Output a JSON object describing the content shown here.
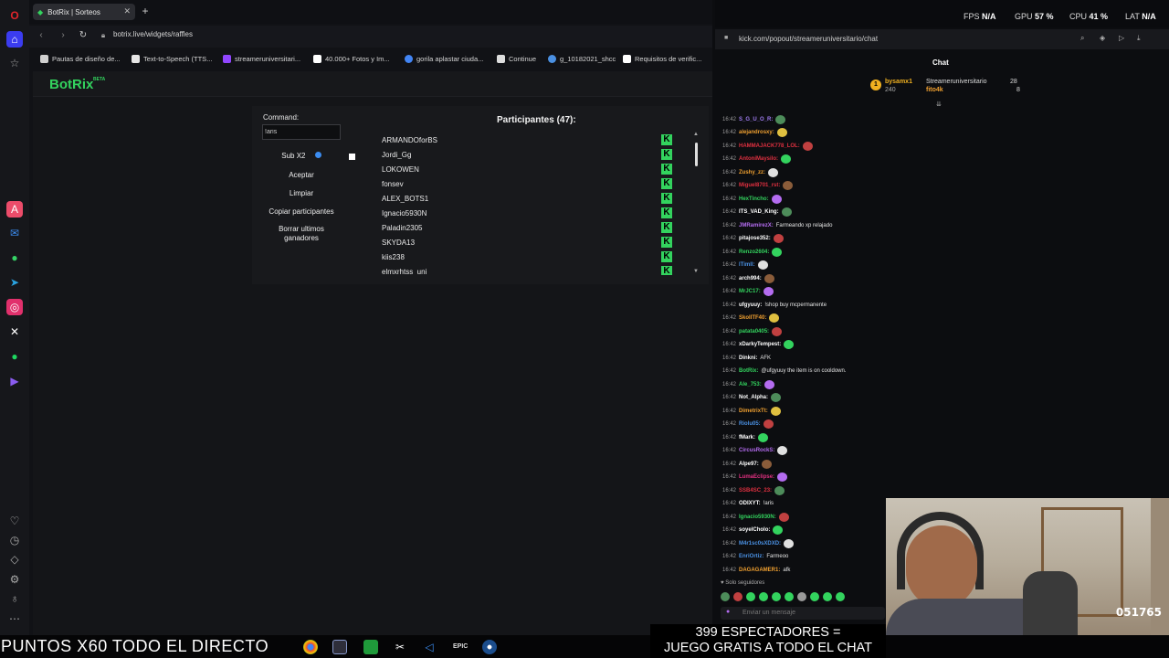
{
  "browser": {
    "tab_title": "BotRix | Sorteos",
    "url": "botrix.live/widgets/raffles",
    "bookmarks": [
      {
        "label": "Pautas de diseño de...",
        "color": "#d0d0d0"
      },
      {
        "label": "Text-to-Speech (TTS...",
        "color": "#e6e6e6"
      },
      {
        "label": "streameruniversitari...",
        "color": "#9146ff"
      },
      {
        "label": "40.000+ Fotos y Im...",
        "color": "#ffffff"
      },
      {
        "label": "gorila aplastar ciuda...",
        "color": "#4285f4"
      },
      {
        "label": "Continue",
        "color": "#dddddd"
      },
      {
        "label": "g_10182021_shcc",
        "color": "#4a90e2"
      },
      {
        "label": "Requisitos de verific...",
        "color": "#ffffff"
      }
    ]
  },
  "botrix": {
    "logo": "BotRix",
    "logo_beta": "BETA",
    "command_label": "Command:",
    "command_value": "!aris",
    "sub_label": "Sub X2",
    "accept": "Aceptar",
    "clear": "Limpiar",
    "copy": "Copiar participantes",
    "delete_winners": "Borrar ultimos ganadores",
    "participants_title": "Participantes (47):",
    "participants": [
      "ARMANDOforBS",
      "Jordi_Gg",
      "LOKOWEN",
      "fonsev",
      "ALEX_BOTS1",
      "Ignacio5930N",
      "Paladin2305",
      "SKYDA13",
      "kiis238",
      "elmxrhtss_uni"
    ],
    "platform_badge": "K",
    "accent": "#33d35e"
  },
  "system": {
    "fps_label": "FPS",
    "fps_value": "N/A",
    "gpu_label": "GPU",
    "gpu_value": "57 %",
    "cpu_label": "CPU",
    "cpu_value": "41 %",
    "lat_label": "LAT",
    "lat_value": "N/A"
  },
  "chat": {
    "url": "kick.com/popout/streameruniversitario/chat",
    "title": "Chat",
    "leaderboard": [
      {
        "rank": "1",
        "name": "bysamx1",
        "points": "240"
      },
      {
        "name": "Streameruniversitario",
        "points": "28"
      },
      {
        "name": "fito4k",
        "points": "8"
      }
    ],
    "messages": [
      {
        "time": "16:42",
        "user": "S_G_U_O_R:",
        "color": "#9f7cf0",
        "text": ""
      },
      {
        "time": "16:42",
        "user": "alejandrosxy:",
        "color": "#f0a030",
        "text": ""
      },
      {
        "time": "16:42",
        "user": "HAMMAJACK778_LOL:",
        "color": "#e03040",
        "text": ""
      },
      {
        "time": "16:42",
        "user": "AntoniMaysilo:",
        "color": "#e03040",
        "text": ""
      },
      {
        "time": "16:42",
        "user": "Zushy_zz:",
        "color": "#f0a030",
        "text": ""
      },
      {
        "time": "16:42",
        "user": "Miguel8701_rst:",
        "color": "#e03040",
        "text": ""
      },
      {
        "time": "16:42",
        "user": "HexTincho:",
        "color": "#33d35e",
        "text": ""
      },
      {
        "time": "16:42",
        "user": "ITS_VAD_King:",
        "color": "#ffffff",
        "text": ""
      },
      {
        "time": "16:42",
        "user": "JMRamirezX:",
        "color": "#b46cf0",
        "text": "Farmeando xp relajado"
      },
      {
        "time": "16:42",
        "user": "pitajose352:",
        "color": "#ffffff",
        "text": ""
      },
      {
        "time": "16:42",
        "user": "Renzo2604:",
        "color": "#33d35e",
        "text": ""
      },
      {
        "time": "16:42",
        "user": "lTimll:",
        "color": "#4a90e2",
        "text": ""
      },
      {
        "time": "16:42",
        "user": "arch994:",
        "color": "#ffffff",
        "text": ""
      },
      {
        "time": "16:42",
        "user": "MrJC17:",
        "color": "#33d35e",
        "text": ""
      },
      {
        "time": "16:42",
        "user": "ufgyuuy:",
        "color": "#ffffff",
        "text": "!shop buy mcpermanente"
      },
      {
        "time": "16:42",
        "user": "SkollTF40:",
        "color": "#f0a030",
        "text": ""
      },
      {
        "time": "16:42",
        "user": "patata0405:",
        "color": "#33d35e",
        "text": ""
      },
      {
        "time": "16:42",
        "user": "xDarkyTempest:",
        "color": "#ffffff",
        "text": ""
      },
      {
        "time": "16:42",
        "user": "Dinkni:",
        "color": "#ffffff",
        "text": "AFK"
      },
      {
        "time": "16:42",
        "user": "BotRix:",
        "color": "#33d35e",
        "text": "@ufgyuuy the item is on cooldown."
      },
      {
        "time": "16:42",
        "user": "Ale_753:",
        "color": "#33d35e",
        "text": ""
      },
      {
        "time": "16:42",
        "user": "Not_Alpha:",
        "color": "#ffffff",
        "text": ""
      },
      {
        "time": "16:42",
        "user": "DimetrixTt:",
        "color": "#f0a030",
        "text": ""
      },
      {
        "time": "16:42",
        "user": "Riolu05:",
        "color": "#4a90e2",
        "text": ""
      },
      {
        "time": "16:42",
        "user": "fMark:",
        "color": "#ffffff",
        "text": ""
      },
      {
        "time": "16:42",
        "user": "CircusRockS:",
        "color": "#b46cf0",
        "text": ""
      },
      {
        "time": "16:42",
        "user": "Alpe97:",
        "color": "#ffffff",
        "text": ""
      },
      {
        "time": "16:42",
        "user": "LumaEclipse:",
        "color": "#e03080",
        "text": ""
      },
      {
        "time": "16:42",
        "user": "SSB4SC_23:",
        "color": "#e03040",
        "text": ""
      },
      {
        "time": "16:42",
        "user": "ODIXYT:",
        "color": "#ffffff",
        "text": "!aris"
      },
      {
        "time": "16:42",
        "user": "Ignacio5930N:",
        "color": "#33d35e",
        "text": ""
      },
      {
        "time": "16:42",
        "user": "soyelCholo:",
        "color": "#ffffff",
        "text": ""
      },
      {
        "time": "16:42",
        "user": "M4r1sc0sXDXD:",
        "color": "#4a90e2",
        "text": ""
      },
      {
        "time": "16:42",
        "user": "EnriOrtiz:",
        "color": "#4a90e2",
        "text": "Farmeoo"
      },
      {
        "time": "16:42",
        "user": "DAGAGAMER1:",
        "color": "#f0a030",
        "text": "afk"
      }
    ],
    "followers_only": "Solo seguidores",
    "input_placeholder": "Enviar un mensaje"
  },
  "overlay": {
    "puntos": "PUNTOS X60 TODO EL DIRECTO",
    "espectadores_line1": "399 ESPECTADORES =",
    "espectadores_line2": "JUEGO GRATIS A TODO EL CHAT",
    "webcam_badge": "051765"
  }
}
